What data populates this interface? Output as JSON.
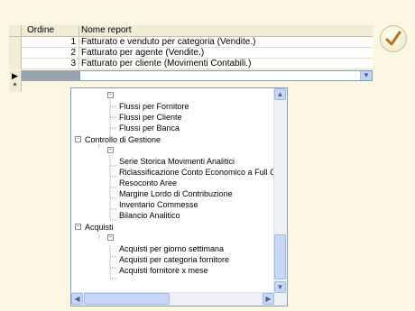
{
  "columns": {
    "order": "Ordine",
    "name": "Nome report"
  },
  "rows": [
    {
      "order": "1",
      "name": "Fatturato e venduto per categoria (Vendite.)"
    },
    {
      "order": "2",
      "name": "Fatturato per agente (Vendite.)"
    },
    {
      "order": "3",
      "name": "Fatturato per cliente (Movimenti Contabili.)"
    }
  ],
  "active_row": {
    "indicator": "▶",
    "name_value": "",
    "dropdown_icon": "chevron-down-icon"
  },
  "new_row": {
    "indicator": "*"
  },
  "tree": [
    {
      "type": "toggle",
      "symbol": "-"
    },
    {
      "type": "leaf",
      "label": "Flussi per Fornitore"
    },
    {
      "type": "leaf",
      "label": "Flussi per Cliente"
    },
    {
      "type": "leaf",
      "label": "Flussi per Banca"
    },
    {
      "type": "group",
      "symbol": "-",
      "label": "Controllo di Gestione"
    },
    {
      "type": "toggle",
      "symbol": "-"
    },
    {
      "type": "leaf",
      "label": "Serie Storica Movimenti Analitici"
    },
    {
      "type": "leaf",
      "label": "Riclassificazione Conto Economico a Full Costi"
    },
    {
      "type": "leaf",
      "label": "Resoconto Aree"
    },
    {
      "type": "leaf",
      "label": "Margine Lordo di Contribuzione"
    },
    {
      "type": "leaf",
      "label": "Inventario Commesse"
    },
    {
      "type": "leaf",
      "label": "Bilancio Analitico"
    },
    {
      "type": "group",
      "symbol": "-",
      "label": "Acquisti"
    },
    {
      "type": "toggle",
      "symbol": "-"
    },
    {
      "type": "leaf",
      "label": "Acquisti per giorno settimana"
    },
    {
      "type": "leaf",
      "label": "Acquisti per categoria fornitore"
    },
    {
      "type": "leaf",
      "label": "Acquisti fornitore x mese"
    }
  ],
  "scroll": {
    "up": "▲",
    "down": "▼",
    "left": "◀",
    "right": "▶"
  },
  "ok_icon": "checkmark-icon"
}
